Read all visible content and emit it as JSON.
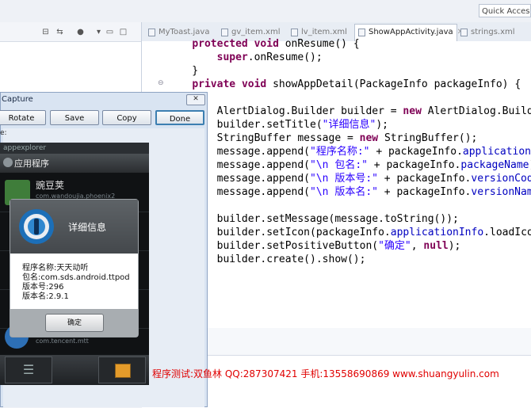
{
  "quick_access": "Quick Access",
  "editor_tabs": [
    {
      "label": "MyToast.java",
      "active": false
    },
    {
      "label": "gv_item.xml",
      "active": false
    },
    {
      "label": "lv_item.xml",
      "active": false
    },
    {
      "label": "ShowAppActivity.java",
      "active": true
    },
    {
      "label": "strings.xml",
      "active": false
    }
  ],
  "code_lines": [
    "    protected void onResume() {",
    "        super.onResume();",
    "    }",
    "    private void showAppDetail(PackageInfo packageInfo) {",
    "",
    "        AlertDialog.Builder builder = new AlertDialog.Builder(",
    "        builder.setTitle(\"详细信息\");",
    "        StringBuffer message = new StringBuffer();",
    "        message.append(\"程序名称:\" + packageInfo.applicationInfo",
    "        message.append(\"\\n 包名:\" + packageInfo.packageName);",
    "        message.append(\"\\n 版本号:\" + packageInfo.versionCode",
    "        message.append(\"\\n 版本名:\" + packageInfo.versionName",
    "",
    "        builder.setMessage(message.toString());",
    "        builder.setIcon(packageInfo.applicationInfo.loadIcon(",
    "        builder.setPositiveButton(\"确定\", null);",
    "        builder.create().show();"
  ],
  "capture_window": {
    "title": "Capture",
    "close": "✕",
    "buttons": {
      "rotate": "Rotate",
      "save": "Save",
      "copy": "Copy",
      "done": "Done"
    },
    "label": "e:"
  },
  "phone": {
    "header": "appexplorer",
    "action_bar": "应用程序",
    "apps": [
      {
        "name": "豌豆荚",
        "package": "com.wandoujia.phoenix2"
      },
      {
        "name": "",
        "package": "com.tencent.mtt"
      }
    ],
    "dialog": {
      "title": "详细信息",
      "lines": [
        "程序名称:天天动听",
        "包名:com.sds.android.ttpod",
        "版本号:296",
        "版本名:2.9.1"
      ],
      "ok": "确定"
    }
  },
  "watermark": "程序测试:双鱼林 QQ:287307421 手机:13558690869 www.shuangyulin.com"
}
